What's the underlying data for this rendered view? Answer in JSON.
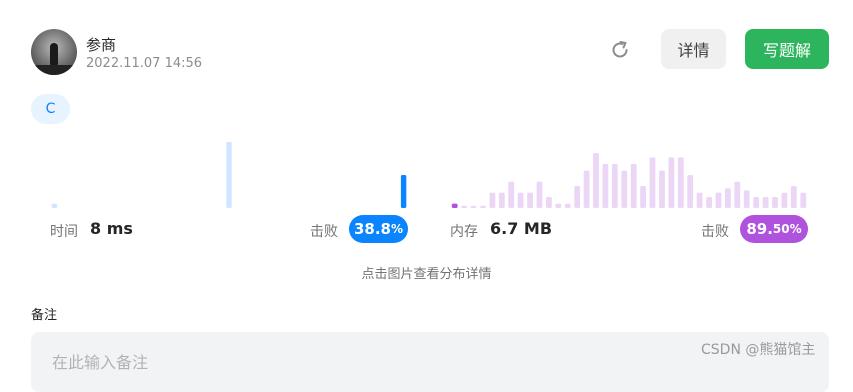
{
  "author": {
    "name": "参商",
    "timestamp": "2022.11.07 14:56"
  },
  "actions": {
    "refresh_icon": "refresh-icon",
    "detail_label": "详情",
    "write_label": "写题解"
  },
  "language_tag": "C",
  "runtime": {
    "label": "时间",
    "value": "8 ms",
    "beat_label": "击败",
    "beat_main": "38.8",
    "beat_unit": "%",
    "beat_color": "#0a84ff",
    "distribution": [
      2,
      0,
      0,
      0,
      0,
      0,
      0,
      0,
      0,
      0,
      0,
      0,
      0,
      0,
      0,
      0,
      0,
      0,
      0,
      0,
      30,
      0,
      0,
      0,
      0,
      0,
      0,
      0,
      0,
      0,
      0,
      0,
      0,
      0,
      0,
      0,
      0,
      0,
      0,
      0,
      15
    ],
    "highlight_index": 40
  },
  "memory": {
    "label": "内存",
    "value": "6.7 MB",
    "beat_label": "击败",
    "beat_main": "89.",
    "beat_unit": "50%",
    "beat_color": "#af52de",
    "distribution": [
      2,
      1,
      1,
      1,
      7,
      7,
      12,
      7,
      7,
      12,
      5,
      2,
      2,
      10,
      17,
      25,
      20,
      20,
      17,
      20,
      10,
      23,
      17,
      23,
      23,
      15,
      7,
      5,
      7,
      9,
      12,
      8,
      5,
      5,
      5,
      7,
      10,
      7
    ],
    "highlight_index": 0
  },
  "chart_hint": "点击图片查看分布详情",
  "note": {
    "label": "备注",
    "placeholder": "在此输入备注"
  },
  "watermark": "CSDN @熊猫馆主"
}
